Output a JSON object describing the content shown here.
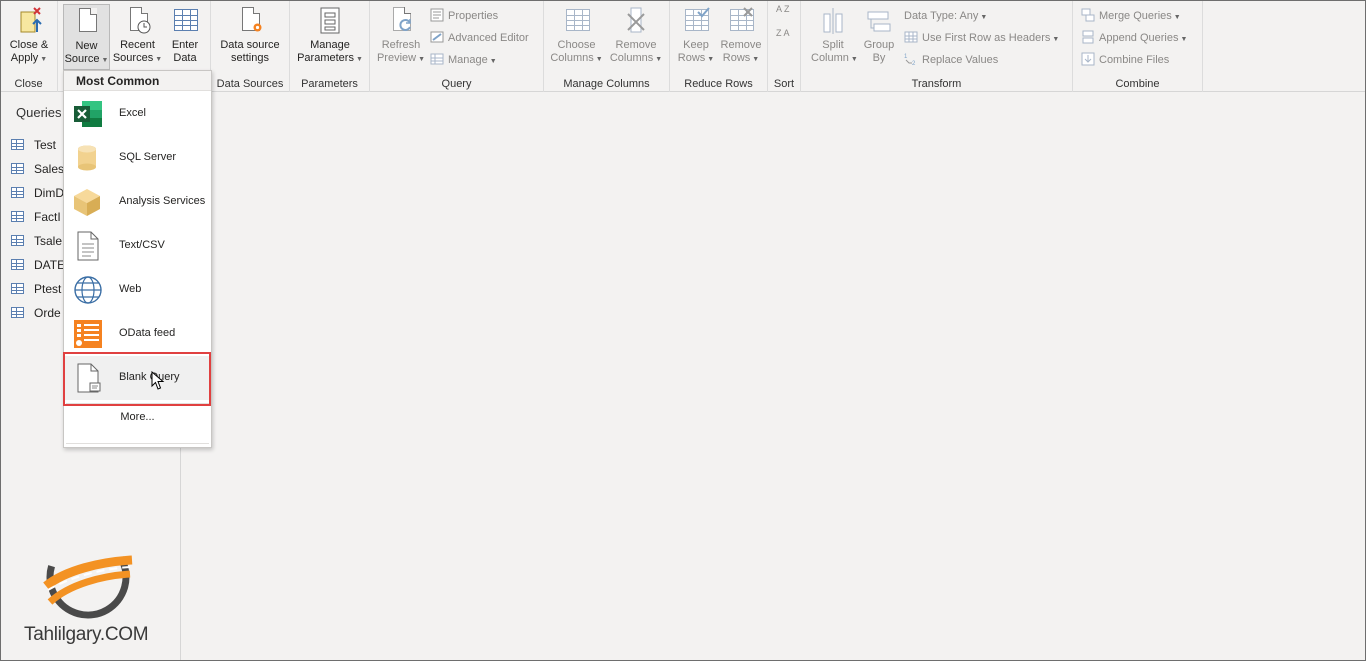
{
  "ribbon": {
    "close_group": {
      "label": "Close",
      "close_apply": "Close &",
      "close_apply_2": "Apply"
    },
    "new_query_group": {
      "new_source": "New",
      "new_source_2": "Source",
      "recent_sources": "Recent",
      "recent_sources_2": "Sources",
      "enter_data": "Enter",
      "enter_data_2": "Data"
    },
    "data_sources_group": {
      "label": "Data Sources",
      "settings": "Data source",
      "settings_2": "settings"
    },
    "parameters_group": {
      "label": "Parameters",
      "manage": "Manage",
      "manage_2": "Parameters"
    },
    "query_group": {
      "label": "Query",
      "refresh": "Refresh",
      "refresh_2": "Preview",
      "properties": "Properties",
      "advanced_editor": "Advanced Editor",
      "manage": "Manage"
    },
    "manage_columns_group": {
      "label": "Manage Columns",
      "choose": "Choose",
      "choose_2": "Columns",
      "remove": "Remove",
      "remove_2": "Columns"
    },
    "reduce_rows_group": {
      "label": "Reduce Rows",
      "keep": "Keep",
      "keep_2": "Rows",
      "remove": "Remove",
      "remove_2": "Rows"
    },
    "sort_group": {
      "label": "Sort",
      "asc": "A Z",
      "desc": "Z A"
    },
    "transform_group": {
      "label": "Transform",
      "split": "Split",
      "split_2": "Column",
      "group": "Group",
      "group_2": "By",
      "data_type": "Data Type: Any",
      "first_row": "Use First Row as Headers",
      "replace": "Replace Values"
    },
    "combine_group": {
      "label": "Combine",
      "merge": "Merge Queries",
      "append": "Append Queries",
      "combine_files": "Combine Files"
    }
  },
  "queries_pane": {
    "title": "Queries",
    "items": [
      "Test",
      "Sales",
      "DimD",
      "FactI",
      "Tsale",
      "DATE",
      "Ptest",
      "Orde"
    ]
  },
  "new_source_menu": {
    "header": "Most Common",
    "items": [
      {
        "label": "Excel",
        "icon": "excel-icon"
      },
      {
        "label": "SQL Server",
        "icon": "database-icon"
      },
      {
        "label": "Analysis Services",
        "icon": "cube-icon"
      },
      {
        "label": "Text/CSV",
        "icon": "text-file-icon"
      },
      {
        "label": "Web",
        "icon": "globe-icon"
      },
      {
        "label": "OData feed",
        "icon": "odata-icon"
      },
      {
        "label": "Blank Query",
        "icon": "blank-query-icon"
      }
    ],
    "more": "More...",
    "highlighted_item": "Blank Query"
  },
  "watermark": {
    "text": "Tahlilgary.COM"
  },
  "colors": {
    "highlight_border": "#e04040",
    "excel_green": "#1e7145",
    "odata_orange": "#f58220",
    "accent_blue": "#5b7fb0"
  }
}
